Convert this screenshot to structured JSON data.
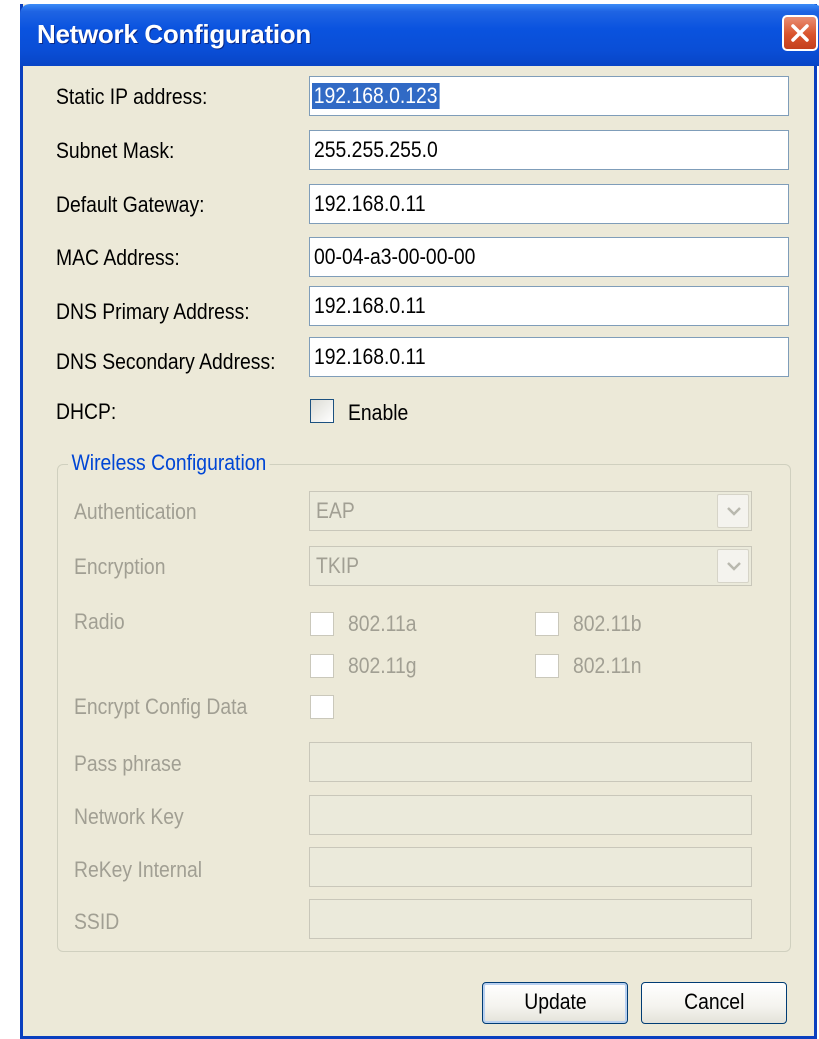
{
  "window": {
    "title": "Network Configuration"
  },
  "fields": {
    "static_ip": {
      "label": "Static IP address:",
      "value": "192.168.0.123"
    },
    "subnet": {
      "label": "Subnet Mask:",
      "value": "255.255.255.0"
    },
    "gateway": {
      "label": "Default Gateway:",
      "value": "192.168.0.11"
    },
    "mac": {
      "label": "MAC Address:",
      "value": "00-04-a3-00-00-00"
    },
    "dns1": {
      "label": "DNS Primary Address:",
      "value": "192.168.0.11"
    },
    "dns2": {
      "label": "DNS Secondary Address:",
      "value": "192.168.0.11"
    }
  },
  "dhcp": {
    "label": "DHCP:",
    "checkbox_label": "Enable",
    "checked": false
  },
  "wireless": {
    "legend": "Wireless Configuration",
    "authentication": {
      "label": "Authentication",
      "value": "EAP"
    },
    "encryption": {
      "label": "Encryption",
      "value": "TKIP"
    },
    "radio": {
      "label": "Radio",
      "options": [
        "802.11a",
        "802.11b",
        "802.11g",
        "802.11n"
      ]
    },
    "encrypt_config": {
      "label": "Encrypt Config Data"
    },
    "pass_phrase": {
      "label": "Pass phrase",
      "value": ""
    },
    "network_key": {
      "label": "Network Key",
      "value": ""
    },
    "rekey": {
      "label": "ReKey Internal",
      "value": ""
    },
    "ssid": {
      "label": "SSID",
      "value": ""
    }
  },
  "buttons": {
    "update": "Update",
    "cancel": "Cancel"
  },
  "colors": {
    "title_bar": "#0a53df",
    "dialog_bg": "#ece9d8",
    "legend": "#0046d5",
    "disabled_text": "#a19f93",
    "close": "#d9532c"
  },
  "icons": {
    "close": "close-icon",
    "dropdown": "chevron-down-icon"
  }
}
